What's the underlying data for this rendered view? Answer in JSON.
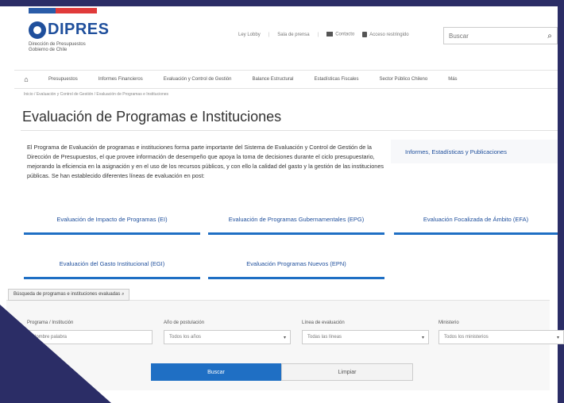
{
  "colors": {
    "brand": "#1f4f9c",
    "accent": "#1f6fc4",
    "frame": "#2b2d66",
    "flag_red": "#e03a3a"
  },
  "header": {
    "logo_text": "DIPRES",
    "logo_sub": "Dirección de Presupuestos Gobierno de Chile",
    "toplinks": [
      "Ley Lobby",
      "Sala de prensa",
      "Contacto",
      "Acceso restringido"
    ],
    "search_placeholder": "Buscar",
    "search_icon": "search-icon"
  },
  "nav": {
    "items": [
      "Presupuestos",
      "Informes Financieros",
      "Evaluación y Control de Gestión",
      "Balance Estructural",
      "Estadísticas Fiscales",
      "Sector Público Chileno",
      "Más"
    ]
  },
  "breadcrumb": "Inicio / Evaluación y Control de Gestión / Evaluación de Programas e Instituciones",
  "page_title": "Evaluación de Programas e Instituciones",
  "intro_text": "El Programa de Evaluación de programas e instituciones forma parte importante del Sistema de Evaluación y Control de Gestión de la Dirección de Presupuestos, el que provee información de desempeño que apoya la toma de decisiones durante el ciclo presupuestario, mejorando la eficiencia en la asignación y en el uso de los recursos públicos, y con ello la calidad del gasto y la gestión de las instituciones públicas. Se han establecido diferentes líneas de evaluación en post:",
  "sidebar_link": "Informes, Estadísticas y Publicaciones",
  "eval_buttons": [
    "Evaluación de Impacto de Programas (EI)",
    "Evaluación de Programas Gubernamentales (EPG)",
    "Evaluación Focalizada de Ámbito (EFA)",
    "Evaluación del Gasto Institucional (EGI)",
    "Evaluación Programas Nuevos (EPN)"
  ],
  "filter": {
    "toggle_label": "Búsqueda de programas e instituciones evaluadas",
    "fields": [
      {
        "label": "Programa / Institución",
        "value": "Nombre palabra"
      },
      {
        "label": "Año de postulación",
        "value": "Todos los años"
      },
      {
        "label": "Línea de evaluación",
        "value": "Todas las líneas"
      },
      {
        "label": "Ministerio",
        "value": "Todos los ministerios"
      }
    ],
    "search_button": "Buscar",
    "clear_button": "Limpiar"
  }
}
